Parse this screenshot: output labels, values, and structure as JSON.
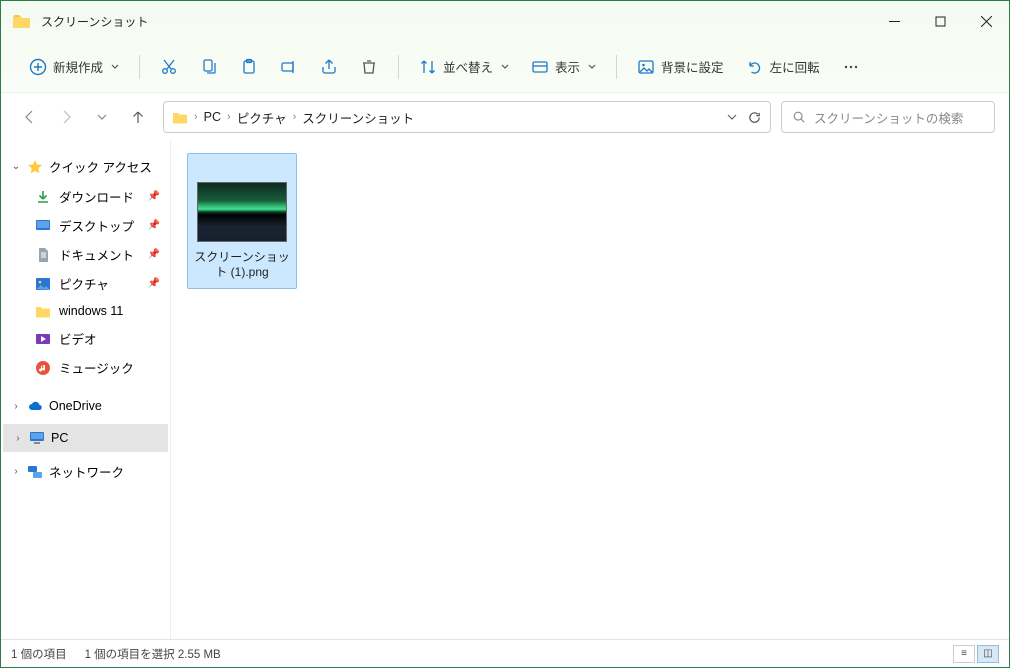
{
  "window": {
    "title": "スクリーンショット"
  },
  "toolbar": {
    "new": "新規作成",
    "sort": "並べ替え",
    "view": "表示",
    "background": "背景に設定",
    "rotate_left": "左に回転"
  },
  "breadcrumbs": {
    "pc": "PC",
    "pictures": "ピクチャ",
    "screenshots": "スクリーンショット"
  },
  "search": {
    "placeholder": "スクリーンショットの検索"
  },
  "sidebar": {
    "quick_access": "クイック アクセス",
    "downloads": "ダウンロード",
    "desktop": "デスクトップ",
    "documents": "ドキュメント",
    "pictures": "ピクチャ",
    "windows11": "windows 11",
    "video": "ビデオ",
    "music": "ミュージック",
    "onedrive": "OneDrive",
    "pc": "PC",
    "network": "ネットワーク"
  },
  "files": {
    "item0_name": "スクリーンショット (1).png"
  },
  "status": {
    "count": "1 個の項目",
    "selected": "1 個の項目を選択 2.55 MB"
  }
}
